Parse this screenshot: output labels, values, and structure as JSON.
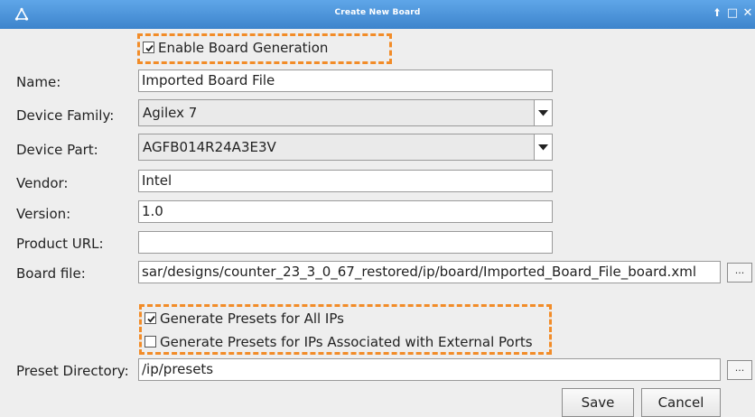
{
  "window": {
    "title": "Create New Board",
    "controls": {
      "pin": "🠩",
      "maximize": "□",
      "close": "✕"
    },
    "accent": "#4a90d9"
  },
  "enable_board_generation": {
    "label": "Enable Board Generation",
    "checked": true
  },
  "fields": {
    "name": {
      "label": "Name:",
      "value": "Imported Board File"
    },
    "device_family": {
      "label": "Device Family:",
      "value": "Agilex 7"
    },
    "device_part": {
      "label": "Device Part:",
      "value": "AGFB014R24A3E3V"
    },
    "vendor": {
      "label": "Vendor:",
      "value": "Intel"
    },
    "version": {
      "label": "Version:",
      "value": "1.0"
    },
    "product_url": {
      "label": "Product URL:",
      "value": ""
    },
    "board_file": {
      "label": "Board file:",
      "value": "sar/designs/counter_23_3_0_67_restored/ip/board/Imported_Board_File_board.xml",
      "browse": "..."
    }
  },
  "presets": {
    "all_ips": {
      "label": "Generate Presets for All IPs",
      "checked": true
    },
    "external_ports": {
      "label": "Generate Presets for IPs Associated with External Ports",
      "checked": false
    }
  },
  "preset_directory": {
    "label": "Preset Directory:",
    "value": "/ip/presets",
    "browse": "..."
  },
  "buttons": {
    "save": "Save",
    "cancel": "Cancel"
  },
  "highlight_color": "#f28c28"
}
